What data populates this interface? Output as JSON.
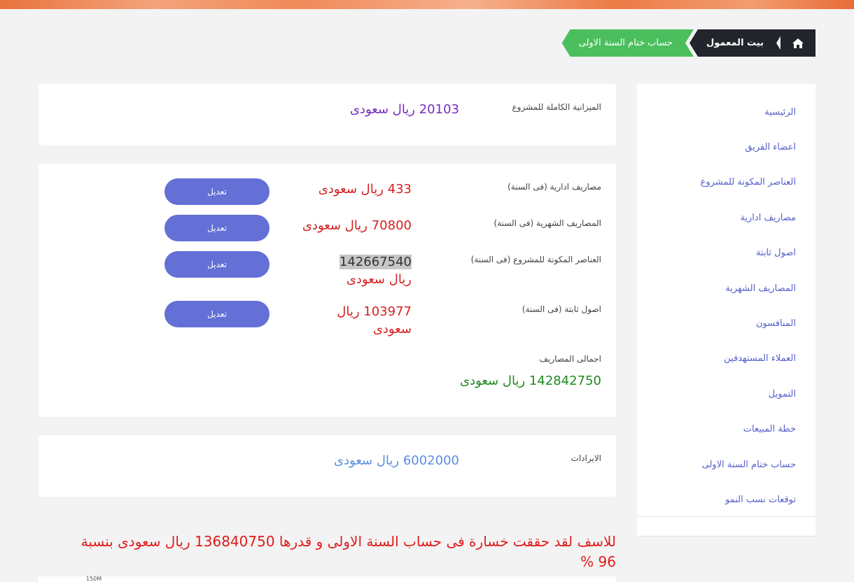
{
  "breadcrumb": {
    "home_icon": "home-icon",
    "items": [
      "بيت المعمول",
      "حساب ختام السنة الاولى"
    ]
  },
  "sidebar": {
    "items": [
      {
        "label": "الرئيسية"
      },
      {
        "label": "اعضاء الفريق"
      },
      {
        "label": "العناصر المكونة للمشروع"
      },
      {
        "label": "مصاريف ادارية"
      },
      {
        "label": "اصول ثابتة"
      },
      {
        "label": "المصاريف الشهرية"
      },
      {
        "label": "المنافسون"
      },
      {
        "label": "العملاء المستهدفين"
      },
      {
        "label": "التمويل"
      },
      {
        "label": "خطة المبيعات"
      },
      {
        "label": "حساب ختام السنة الاولى"
      },
      {
        "label": "توقعات نسب النمو"
      }
    ]
  },
  "budget": {
    "label": "الميزانية الكاملة للمشروع",
    "value": "20103 ريال سعودى"
  },
  "expenses": {
    "rows": [
      {
        "label": "مصاريف ادارية (فى السنة)",
        "value": "433 ريال سعودى",
        "button": "تعديل"
      },
      {
        "label": "المصاريف الشهرية (فى السنة)",
        "value": "70800 ريال سعودى",
        "button": "تعديل"
      },
      {
        "label": "العناصر المكونة للمشروع (فى السنة)",
        "value_number": "142667540",
        "value_unit": "ريال سعودى",
        "button": "تعديل"
      },
      {
        "label": "اصول ثابتة (فى السنة)",
        "value": "103977 ريال سعودى",
        "button": "تعديل"
      }
    ],
    "total_label": "اجمالى المصاريف",
    "total_value": "142842750 ريال سعودى"
  },
  "revenue": {
    "label": "الايرادات",
    "value": "6002000 ريال سعودى"
  },
  "loss_message": "للاسف لقد حققت خسارة فى حساب السنة الاولى و قدرها 136840750 ريال سعودى بنسبة 96 %",
  "chart_tick": "150M",
  "colors": {
    "accent": "#6470d6",
    "breadcrumb_dark": "#22252c",
    "breadcrumb_green": "#4bbf5d",
    "loss": "#e01b1b",
    "total": "#1e8a1e",
    "revenue": "#5b8ee0",
    "budget": "#7a2dbd"
  }
}
